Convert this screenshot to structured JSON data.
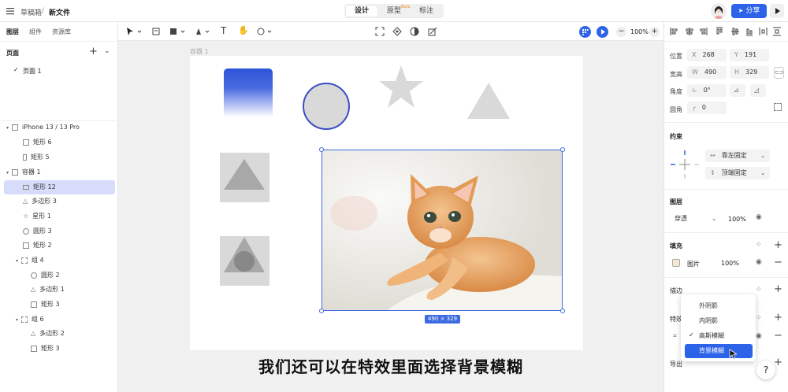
{
  "topbar": {
    "breadcrumb_root": "草稿箱",
    "breadcrumb_sep": "/",
    "file_name": "新文件",
    "tabs": [
      {
        "label": "设计"
      },
      {
        "label": "原型"
      },
      {
        "label": "标注"
      }
    ],
    "beta_badge": "Beta",
    "share_label": "分享"
  },
  "left_panel": {
    "tabs": [
      "图层",
      "组件",
      "资源库"
    ],
    "pages_title": "页面",
    "pages": [
      "页面 1"
    ],
    "tree": [
      {
        "label": "iPhone 13 / 13 Pro",
        "icon": "frame-icon"
      },
      {
        "label": "矩形 6",
        "icon": "rect-icon"
      },
      {
        "label": "矩形 5",
        "icon": "rect-icon"
      },
      {
        "label": "容器 1",
        "icon": "frame-icon"
      },
      {
        "label": "矩形 12",
        "icon": "rect-icon"
      },
      {
        "label": "多边形 3",
        "icon": "triangle-icon"
      },
      {
        "label": "星形 1",
        "icon": "star-icon"
      },
      {
        "label": "圆形 3",
        "icon": "circle-icon"
      },
      {
        "label": "矩形 2",
        "icon": "rect-icon"
      },
      {
        "label": "组 4",
        "icon": "group-icon"
      },
      {
        "label": "圆形 2",
        "icon": "circle-icon"
      },
      {
        "label": "多边形 1",
        "icon": "triangle-icon"
      },
      {
        "label": "矩形 3",
        "icon": "rect-icon"
      },
      {
        "label": "组 6",
        "icon": "group-icon"
      },
      {
        "label": "多边形 2",
        "icon": "triangle-icon"
      },
      {
        "label": "矩形 3",
        "icon": "rect-icon"
      }
    ]
  },
  "toolbar": {
    "zoom": "100%",
    "zoom_minus": "−",
    "zoom_plus": "+"
  },
  "canvas": {
    "container_label": "容器 1",
    "size_badge": "490 × 329"
  },
  "right_panel": {
    "position_label": "位置",
    "x_key": "X",
    "x": "268",
    "y_key": "Y",
    "y": "191",
    "size_label": "宽高",
    "w_key": "W",
    "w": "490",
    "h_key": "H",
    "h": "329",
    "angle_label": "角度",
    "angle": "0°",
    "radius_label": "圆角",
    "radius": "0",
    "constraints_title": "约束",
    "constraint_h": "靠左固定",
    "constraint_v": "顶端固定",
    "layer_title": "图层",
    "blend_mode": "穿透",
    "layer_opacity": "100%",
    "fill_title": "填充",
    "fill_type": "图片",
    "fill_opacity": "100%",
    "stroke_title": "描边",
    "effects_title": "特效",
    "export_title": "导出"
  },
  "effects_menu": {
    "items": [
      "外阴影",
      "内阴影",
      "高斯模糊",
      "背景模糊"
    ],
    "checked": "高斯模糊",
    "highlighted": "背景模糊"
  },
  "caption": "我们还可以在特效里面选择背景模糊",
  "colors": {
    "accent": "#2d63e8",
    "selection": "#d6dcfa",
    "shape_gray": "#d9d9d9"
  }
}
